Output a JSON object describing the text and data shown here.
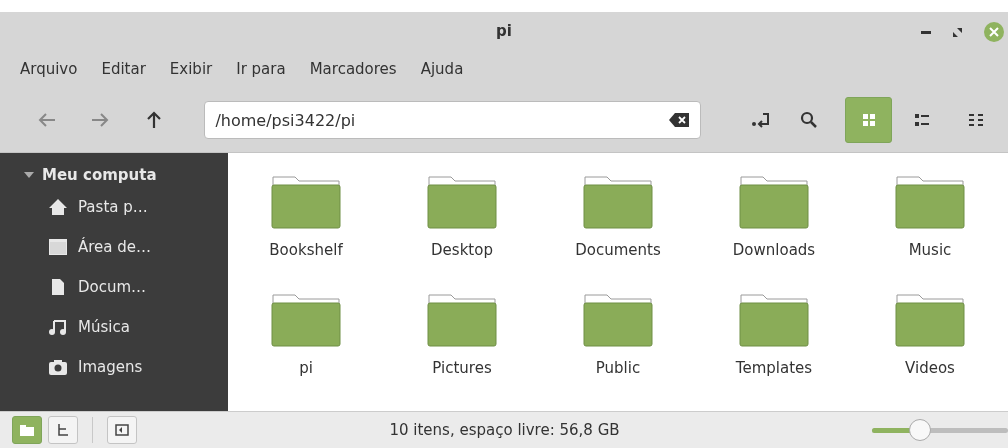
{
  "window": {
    "title": "pi"
  },
  "menu": [
    "Arquivo",
    "Editar",
    "Exibir",
    "Ir para",
    "Marcadores",
    "Ajuda"
  ],
  "toolbar": {
    "path": "/home/psi3422/pi",
    "views": [
      {
        "kind": "icons",
        "selected": true
      },
      {
        "kind": "list",
        "selected": false
      },
      {
        "kind": "compact",
        "selected": false
      }
    ]
  },
  "sidebar": {
    "heading": "Meu computa",
    "expanded": true,
    "items": [
      {
        "kind": "home",
        "label": "Pasta p…"
      },
      {
        "kind": "desktop",
        "label": "Área de…"
      },
      {
        "kind": "document",
        "label": "Docum…"
      },
      {
        "kind": "music",
        "label": "Música"
      },
      {
        "kind": "camera",
        "label": "Imagens"
      }
    ]
  },
  "files": [
    {
      "name": "Bookshelf"
    },
    {
      "name": "Desktop"
    },
    {
      "name": "Documents"
    },
    {
      "name": "Downloads"
    },
    {
      "name": "Music"
    },
    {
      "name": "pi"
    },
    {
      "name": "Pictures"
    },
    {
      "name": "Public"
    },
    {
      "name": "Templates"
    },
    {
      "name": "Videos"
    }
  ],
  "status_bar": {
    "panes": [
      {
        "kind": "places",
        "selected": true
      },
      {
        "kind": "tree",
        "selected": false
      }
    ],
    "text": "10 itens, espaço livre: 56,8 GB",
    "zoom": {
      "level": 0.35
    }
  }
}
